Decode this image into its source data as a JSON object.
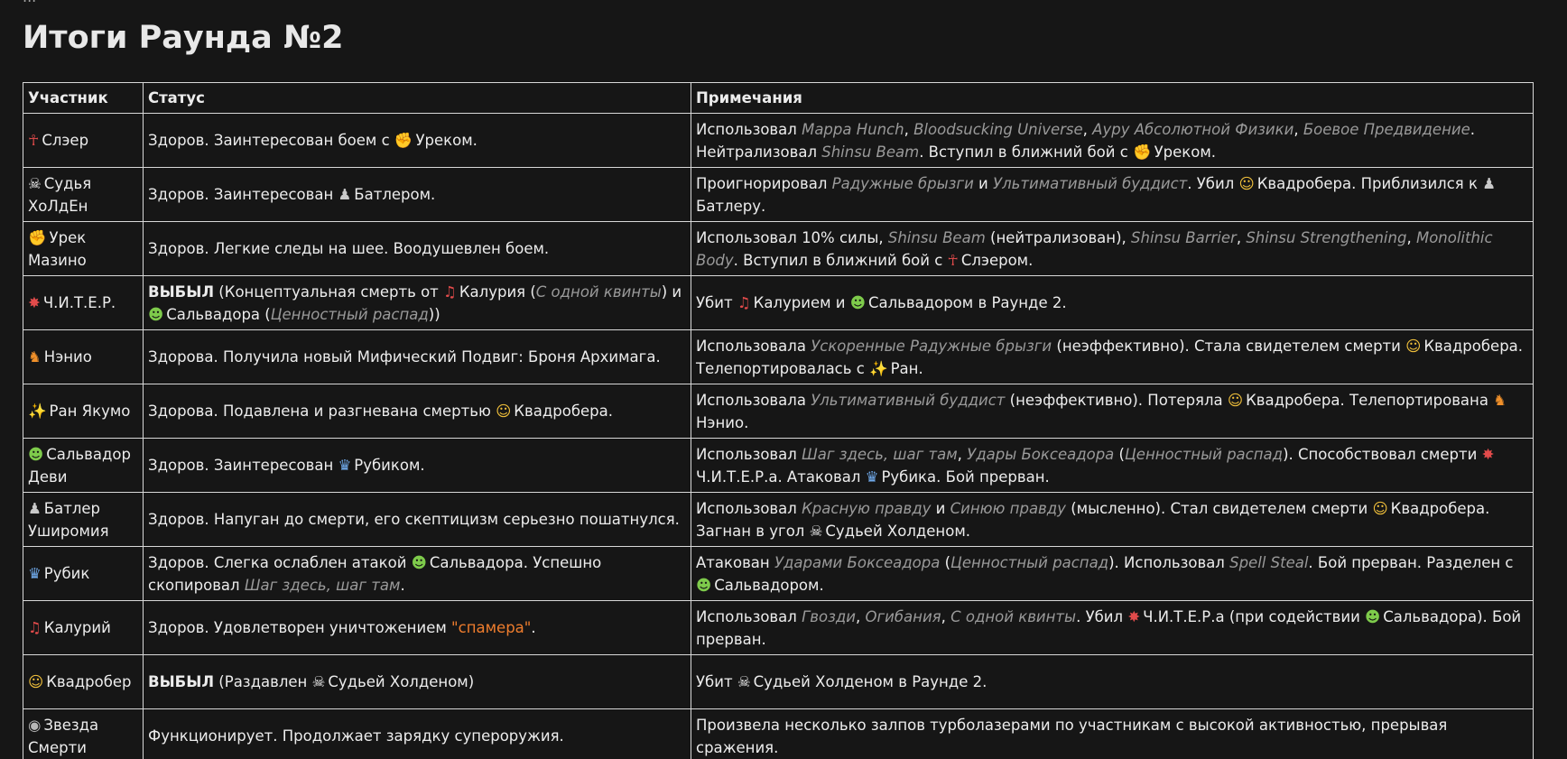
{
  "page": {
    "cut_line": "...",
    "title": "Итоги Раунда №2"
  },
  "table": {
    "headers": [
      "Участник",
      "Статус",
      "Примечания"
    ],
    "rows": [
      {
        "participant": {
          "icon": "vampire-icon",
          "name": "Слэер"
        },
        "status": [
          {
            "t": "Здоров. Заинтересован боем с "
          },
          {
            "icon": "flexed-biceps-icon",
            "t": "Уреком."
          }
        ],
        "notes": [
          {
            "t": "Использовал "
          },
          {
            "em": "Mappa Hunch"
          },
          {
            "t": ", "
          },
          {
            "em": "Bloodsucking Universe"
          },
          {
            "t": ", "
          },
          {
            "em": "Ауру Абсолютной Физики"
          },
          {
            "t": ", "
          },
          {
            "em": "Боевое Предвидение"
          },
          {
            "t": ". Нейтрализовал "
          },
          {
            "em": "Shinsu Beam"
          },
          {
            "t": ". Вступил в ближний бой с "
          },
          {
            "icon": "flexed-biceps-icon",
            "t": "Уреком."
          }
        ]
      },
      {
        "participant": {
          "icon": "skull-icon",
          "name": "Судья ХоЛдЕн"
        },
        "status": [
          {
            "t": "Здоров. Заинтересован "
          },
          {
            "icon": "chess-pawn-icon",
            "t": "Батлером."
          }
        ],
        "notes": [
          {
            "t": "Проигнорировал "
          },
          {
            "em": "Радужные брызги"
          },
          {
            "t": " и "
          },
          {
            "em": "Ультимативный буддист"
          },
          {
            "t": ". Убил "
          },
          {
            "icon": "cat-face-icon",
            "t": "Квадробера. Приблизился к "
          },
          {
            "icon": "chess-pawn-icon",
            "t": "Батлеру."
          }
        ]
      },
      {
        "participant": {
          "icon": "flexed-biceps-icon",
          "name": "Урек Мазино"
        },
        "status": [
          {
            "t": "Здоров. Легкие следы на шее. Воодушевлен боем."
          }
        ],
        "notes": [
          {
            "t": "Использовал 10% силы, "
          },
          {
            "em": "Shinsu Beam"
          },
          {
            "t": " (нейтрализован), "
          },
          {
            "em": "Shinsu Barrier"
          },
          {
            "t": ", "
          },
          {
            "em": "Shinsu Strengthening"
          },
          {
            "t": ", "
          },
          {
            "em": "Monolithic Body"
          },
          {
            "t": ". Вступил в ближний бой с "
          },
          {
            "icon": "vampire-icon",
            "t": "Слэером."
          }
        ]
      },
      {
        "participant": {
          "icon": "collision-icon",
          "name": "Ч.И.Т.Е.Р."
        },
        "status": [
          {
            "b": "ВЫБЫЛ"
          },
          {
            "t": " (Концептуальная смерть от "
          },
          {
            "icon": "guitar-icon",
            "t": "Калурия ("
          },
          {
            "em": "С одной квинты"
          },
          {
            "t": ") и "
          },
          {
            "icon": "alien-icon",
            "t": "Сальвадора ("
          },
          {
            "em": "Ценностный распад"
          },
          {
            "t": "))"
          }
        ],
        "notes": [
          {
            "t": "Убит "
          },
          {
            "icon": "guitar-icon",
            "t": "Калурием и "
          },
          {
            "icon": "alien-icon",
            "t": "Сальвадором в Раунде 2."
          }
        ]
      },
      {
        "participant": {
          "icon": "fox-icon",
          "name": "Нэнио"
        },
        "status": [
          {
            "t": "Здорова. Получила новый Мифический Подвиг: Броня Архимага."
          }
        ],
        "notes": [
          {
            "t": "Использовала "
          },
          {
            "em": "Ускоренные Радужные брызги"
          },
          {
            "t": " (неэффективно). Стала свидетелем смерти "
          },
          {
            "icon": "cat-face-icon",
            "t": "Квадробера. Телепортировалась с "
          },
          {
            "icon": "sparkles-icon",
            "t": "Ран."
          }
        ]
      },
      {
        "participant": {
          "icon": "sparkles-icon",
          "name": "Ран Якумо"
        },
        "status": [
          {
            "t": "Здорова. Подавлена и разгневана смертью "
          },
          {
            "icon": "cat-face-icon",
            "t": "Квадробера."
          }
        ],
        "notes": [
          {
            "t": "Использовала "
          },
          {
            "em": "Ультимативный буддист"
          },
          {
            "t": " (неэффективно). Потеряла "
          },
          {
            "icon": "cat-face-icon",
            "t": "Квадробера. Телепортирована "
          },
          {
            "icon": "fox-icon",
            "t": "Нэнио."
          }
        ]
      },
      {
        "participant": {
          "icon": "alien-icon",
          "name": "Сальвадор Деви"
        },
        "status": [
          {
            "t": "Здоров. Заинтересован "
          },
          {
            "icon": "mage-icon",
            "t": "Рубиком."
          }
        ],
        "notes": [
          {
            "t": "Использовал "
          },
          {
            "em": "Шаг здесь, шаг там"
          },
          {
            "t": ", "
          },
          {
            "em": "Удары Боксеадора"
          },
          {
            "t": " ("
          },
          {
            "em": "Ценностный распад"
          },
          {
            "t": "). Способствовал смерти "
          },
          {
            "icon": "collision-icon",
            "t": "Ч.И.Т.Е.Р.а. Атаковал "
          },
          {
            "icon": "mage-icon",
            "t": "Рубика. Бой прерван."
          }
        ]
      },
      {
        "participant": {
          "icon": "chess-pawn-icon",
          "name": "Батлер Уширомия"
        },
        "status": [
          {
            "t": "Здоров. Напуган до смерти, его скептицизм серьезно пошатнулся."
          }
        ],
        "notes": [
          {
            "t": "Использовал "
          },
          {
            "em": "Красную правду"
          },
          {
            "t": " и "
          },
          {
            "em": "Синюю правду"
          },
          {
            "t": " (мысленно). Стал свидетелем смерти "
          },
          {
            "icon": "cat-face-icon",
            "t": "Квадробера. Загнан в угол "
          },
          {
            "icon": "skull-icon",
            "t": "Судьей Холденом."
          }
        ]
      },
      {
        "participant": {
          "icon": "mage-icon",
          "name": "Рубик"
        },
        "status": [
          {
            "t": "Здоров. Слегка ослаблен атакой "
          },
          {
            "icon": "alien-icon",
            "t": "Сальвадора. Успешно скопировал "
          },
          {
            "em": "Шаг здесь, шаг там"
          },
          {
            "t": "."
          }
        ],
        "notes": [
          {
            "t": "Атакован "
          },
          {
            "em": "Ударами Боксеадора"
          },
          {
            "t": " ("
          },
          {
            "em": "Ценностный распад"
          },
          {
            "t": "). Использовал "
          },
          {
            "em": "Spell Steal"
          },
          {
            "t": ". Бой прерван. Разделен с "
          },
          {
            "icon": "alien-icon",
            "t": "Сальвадором."
          }
        ]
      },
      {
        "participant": {
          "icon": "guitar-icon",
          "name": "Калурий"
        },
        "status": [
          {
            "t": "Здоров. Удовлетворен уничтожением "
          },
          {
            "orange": "\"спамера\""
          },
          {
            "t": "."
          }
        ],
        "notes": [
          {
            "t": "Использовал "
          },
          {
            "em": "Гвозди"
          },
          {
            "t": ", "
          },
          {
            "em": "Огибания"
          },
          {
            "t": ", "
          },
          {
            "em": "С одной квинты"
          },
          {
            "t": ". Убил "
          },
          {
            "icon": "collision-icon",
            "t": "Ч.И.Т.Е.Р.а (при содействии "
          },
          {
            "icon": "alien-icon",
            "t": "Сальвадора). Бой прерван."
          }
        ]
      },
      {
        "participant": {
          "icon": "cat-face-icon",
          "name": "Квадробер"
        },
        "status": [
          {
            "b": "ВЫБЫЛ"
          },
          {
            "t": " (Раздавлен "
          },
          {
            "icon": "skull-icon",
            "t": "Судьей Холденом)"
          }
        ],
        "notes": [
          {
            "t": "Убит "
          },
          {
            "icon": "skull-icon",
            "t": "Судьей Холденом в Раунде 2."
          }
        ]
      },
      {
        "participant": {
          "icon": "death-star-icon",
          "name": "Звезда Смерти"
        },
        "status": [
          {
            "t": "Функционирует. Продолжает зарядку супероружия."
          }
        ],
        "notes": [
          {
            "t": "Произвела несколько залпов турболазерами по участникам с высокой активностью, прерывая сражения."
          }
        ]
      }
    ]
  },
  "icons": {
    "vampire-icon": {
      "glyph": "☥",
      "color": "#e24b4b"
    },
    "skull-icon": {
      "glyph": "☠",
      "color": "#f4f4f4"
    },
    "flexed-biceps-icon": {
      "glyph": "✊",
      "color": "#f2c13b"
    },
    "chess-pawn-icon": {
      "glyph": "♟",
      "color": "#c9c9c9"
    },
    "cat-face-icon": {
      "glyph": "☺",
      "color": "#f2c13b"
    },
    "collision-icon": {
      "glyph": "✸",
      "color": "#e24b4b"
    },
    "guitar-icon": {
      "glyph": "♫",
      "color": "#e24b4b"
    },
    "alien-icon": {
      "glyph": "☻",
      "color": "#7ecb4b"
    },
    "fox-icon": {
      "glyph": "♞",
      "color": "#f0902a"
    },
    "sparkles-icon": {
      "glyph": "✨",
      "color": "#f2c13b"
    },
    "mage-icon": {
      "glyph": "♛",
      "color": "#6fa8e8"
    },
    "death-star-icon": {
      "glyph": "◉",
      "color": "#b8b8b8"
    }
  },
  "colors": {
    "background": "#161616",
    "text": "#ececec",
    "italic_reference": "#9a9a9a",
    "accent_orange": "#ef7d2d",
    "border": "#d8d8d8"
  }
}
